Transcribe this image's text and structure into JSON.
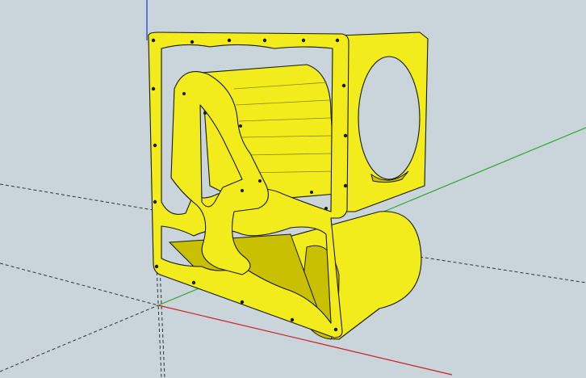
{
  "viewport": {
    "background_color": "#c9d4db",
    "model_fill_color": "#f2ec1c",
    "model_shade_color": "#c8c000",
    "model_dark_color": "#8a8400",
    "edge_color": "#1a1a00",
    "axis_colors": {
      "red": "#cc2020",
      "green": "#22aa22",
      "blue": "#2233cc",
      "hidden": "#333333"
    }
  }
}
